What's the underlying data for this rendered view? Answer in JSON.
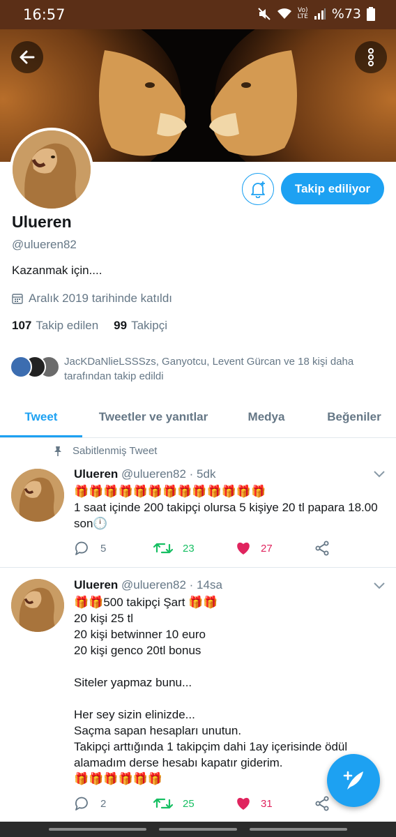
{
  "status_bar": {
    "time": "16:57",
    "battery": "%73",
    "network_label": "LTE"
  },
  "profile": {
    "name": "Ulueren",
    "handle": "@ulueren82",
    "bio": "Kazanmak için....",
    "joined": "Aralık 2019 tarihinde katıldı",
    "following_count": "107",
    "following_label": "Takip edilen",
    "followers_count": "99",
    "followers_label": "Takipçi",
    "follow_button_label": "Takip ediliyor",
    "followed_by_text": "JacKDaNlieLSSSzs, Ganyotcu, Levent Gürcan ve 18 kişi daha tarafından takip edildi"
  },
  "tabs": [
    {
      "label": "Tweet",
      "active": true
    },
    {
      "label": "Tweetler ve yanıtlar",
      "active": false
    },
    {
      "label": "Medya",
      "active": false
    },
    {
      "label": "Beğeniler",
      "active": false
    }
  ],
  "pinned_label": "Sabitlenmiş Tweet",
  "tweets": [
    {
      "name": "Ulueren",
      "handle": "@ulueren82",
      "time": "· 5dk",
      "body": "🎁🎁🎁🎁🎁🎁🎁🎁🎁🎁🎁🎁🎁\n1 saat içinde 200 takipçi olursa 5 kişiye 20 tl papara 18.00 son🕛",
      "replies": "5",
      "retweets": "23",
      "likes": "27"
    },
    {
      "name": "Ulueren",
      "handle": "@ulueren82",
      "time": "· 14sa",
      "body": "🎁🎁500 takipçi Şart 🎁🎁\n20 kişi 25 tl\n20 kişi betwinner 10 euro\n20 kişi genco 20tl bonus\n\nSiteler yapmaz bunu...\n\nHer sey sizin elinizde...\nSaçma sapan hesapları unutun.\nTakipçi arttığında 1 takipçim dahi 1ay içerisinde ödül alamadım derse hesabı kapatır giderim.\n🎁🎁🎁🎁🎁🎁",
      "replies": "2",
      "retweets": "25",
      "likes": "31"
    }
  ],
  "colors": {
    "accent": "#1da1f2",
    "retweet": "#17bf63",
    "like": "#e0245e",
    "muted": "#657786",
    "status_bar": "#5b2f17"
  }
}
